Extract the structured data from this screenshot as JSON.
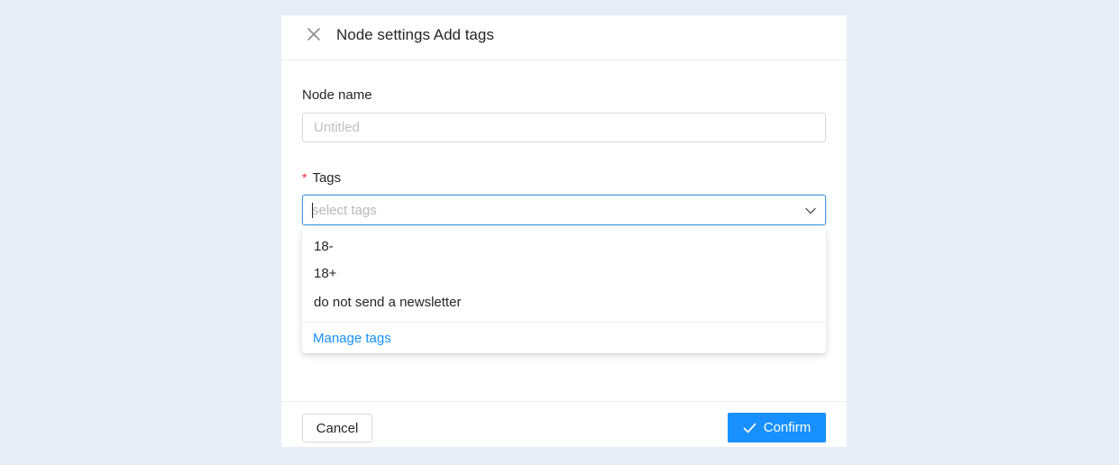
{
  "modal": {
    "title": "Node settings Add tags"
  },
  "form": {
    "node_name": {
      "label": "Node name",
      "value": "",
      "placeholder": "Untitled"
    },
    "tags": {
      "required_mark": "*",
      "label": "Tags",
      "placeholder": "select tags",
      "options": [
        "18-",
        "18+",
        "do not send a newsletter"
      ],
      "manage_link": "Manage tags"
    }
  },
  "footer": {
    "cancel_label": "Cancel",
    "confirm_label": "Confirm"
  },
  "icons": {
    "close": "close-icon",
    "dropdown": "chevron-down-icon",
    "confirm": "check-icon"
  },
  "colors": {
    "background": "#e6edf7",
    "primary": "#1890ff",
    "required": "#f5222d",
    "focus_border": "#4096e0"
  }
}
